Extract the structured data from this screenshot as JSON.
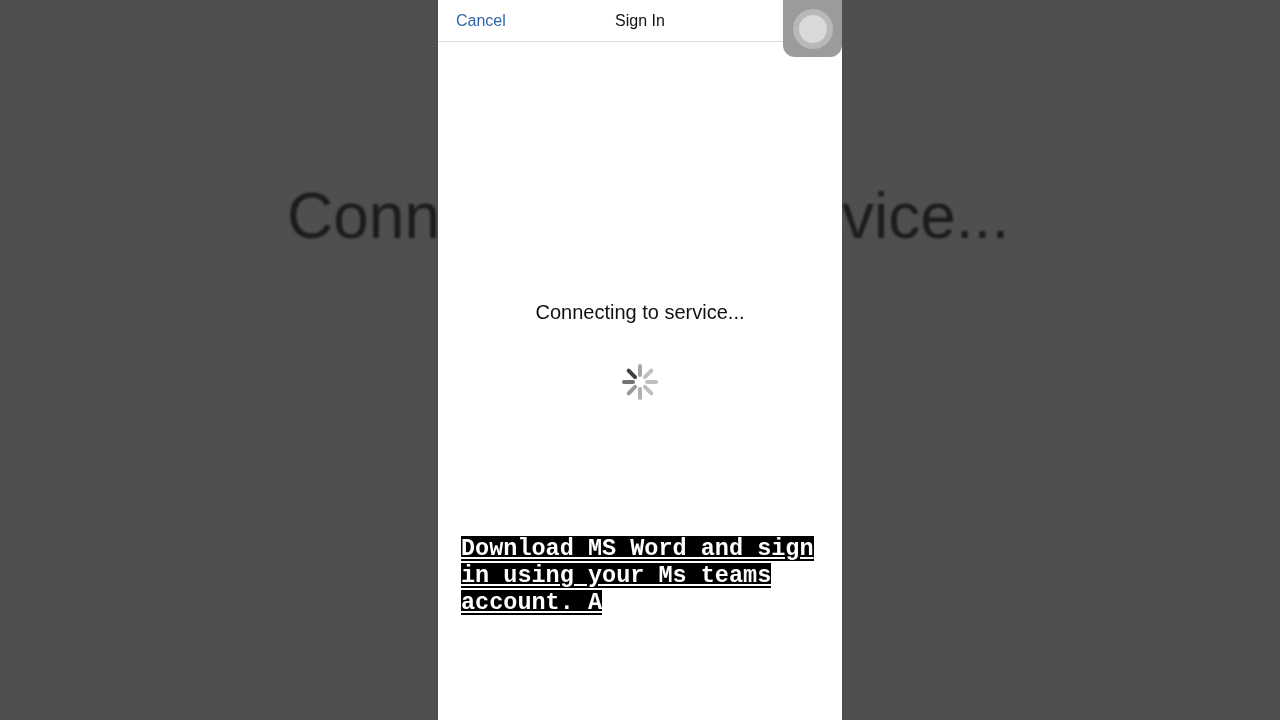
{
  "background": {
    "left_text": "Conn",
    "right_text": "vice..."
  },
  "nav_bar": {
    "cancel": "Cancel",
    "title": "Sign In"
  },
  "status_text": "Connecting to service...",
  "caption_lines": [
    "Download MS Word and sign",
    "in using your Ms teams",
    "account. A"
  ]
}
